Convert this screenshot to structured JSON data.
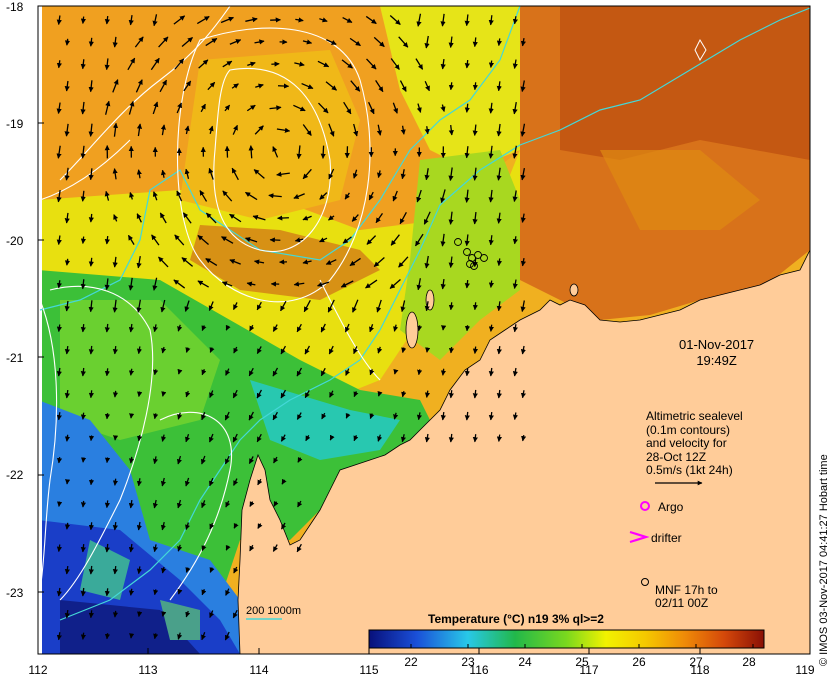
{
  "map": {
    "lat_ticks": [
      "-18",
      "-19",
      "-20",
      "-21",
      "-22",
      "-23"
    ],
    "lon_ticks": [
      "112",
      "113",
      "114",
      "115",
      "116",
      "117",
      "118",
      "119"
    ],
    "datestamp_date": "01-Nov-2017",
    "datestamp_time": "19:49Z",
    "legend": {
      "title": "Altimetric sealevel",
      "line2": "(0.1m contours)",
      "line3": "and velocity for",
      "line4": "28-Oct 12Z",
      "line5": "0.5m/s (1kt 24h)"
    },
    "markers": {
      "argo": "Argo",
      "drifter": "drifter",
      "mnf_line1": "MNF 17h to",
      "mnf_line2": "02/11 00Z"
    },
    "bathymetry_label": "200  1000m",
    "colorbar": {
      "title": "Temperature (°C) n19 3% ql>=2",
      "ticks": [
        "22",
        "23",
        "24",
        "25",
        "26",
        "27",
        "28"
      ],
      "range": [
        21,
        28.5
      ]
    },
    "credit": "© IMOS 03-Nov-2017 04:41:27 Hobart time",
    "colors": {
      "land": "#FFCC99",
      "bathy_200": "#44D8D8",
      "contour": "#FFFFFF",
      "argo": "#FF00FF",
      "drifter": "#FF00FF"
    }
  }
}
